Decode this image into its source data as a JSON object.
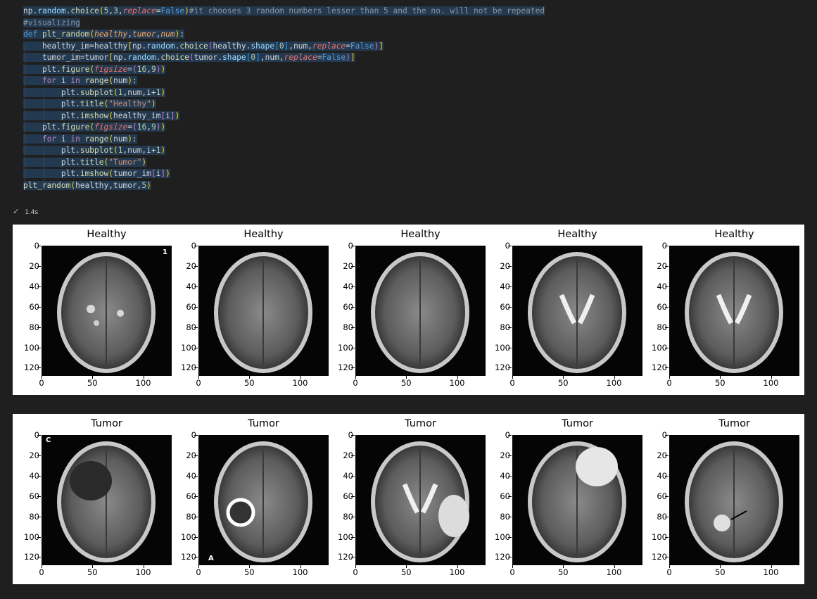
{
  "code": {
    "lines": [
      "np.random.choice(5,3,replace=False)#it chooses 3 random numbers lesser than 5 and the no. will not be repeated",
      "#visualizing",
      "def plt_random(healthy,tumor,num):",
      "    healthy_im=healthy[np.random.choice(healthy.shape[0],num,replace=False)]",
      "    tumor_im=tumor[np.random.choice(tumor.shape[0],num,replace=False)]",
      "    plt.figure(figsize=(16,9))",
      "    for i in range(num):",
      "        plt.subplot(1,num,i+1)",
      "        plt.title(\"Healthy\")",
      "        plt.imshow(healthy_im[i])",
      "    plt.figure(figsize=(16,9))",
      "    for i in range(num):",
      "        plt.subplot(1,num,i+1)",
      "        plt.title(\"Tumor\")",
      "        plt.imshow(tumor_im[i])",
      "plt_random(healthy,tumor,5)"
    ]
  },
  "status": {
    "icon": "check-icon",
    "time": "1.4s",
    "color": "#89d185"
  },
  "figures": [
    {
      "title": "Healthy",
      "panels": [
        {
          "title": "Healthy",
          "image": "mri-axial-flair-bright-spots"
        },
        {
          "title": "Healthy",
          "image": "mri-axial-flair"
        },
        {
          "title": "Healthy",
          "image": "mri-axial-flair-dark"
        },
        {
          "title": "Healthy",
          "image": "mri-axial-t2-ventricles"
        },
        {
          "title": "Healthy",
          "image": "mri-axial-t2-bright-ventricles"
        }
      ]
    },
    {
      "title": "Tumor",
      "panels": [
        {
          "title": "Tumor",
          "image": "mri-dark-cystic-lesion"
        },
        {
          "title": "Tumor",
          "image": "mri-ring-enhancing-lesion"
        },
        {
          "title": "Tumor",
          "image": "mri-t2-edema"
        },
        {
          "title": "Tumor",
          "image": "mri-frontal-mass"
        },
        {
          "title": "Tumor",
          "image": "mri-small-posterior-lesion"
        }
      ]
    }
  ],
  "axis": {
    "yticks": [
      "0",
      "20",
      "40",
      "60",
      "80",
      "100",
      "120"
    ],
    "xticks": [
      "0",
      "50",
      "100"
    ]
  },
  "image_overlays": {
    "healthy_0_corner": "1",
    "tumor_0_corner": "C",
    "tumor_1_corner": "A"
  },
  "chart_data": {
    "type": "heatmap",
    "grid": "2 rows x 5 images",
    "row_titles": [
      "Healthy",
      "Tumor"
    ],
    "xlim": [
      0,
      128
    ],
    "ylim": [
      128,
      0
    ],
    "xticks": [
      0,
      50,
      100
    ],
    "yticks": [
      0,
      20,
      40,
      60,
      80,
      100,
      120
    ]
  }
}
